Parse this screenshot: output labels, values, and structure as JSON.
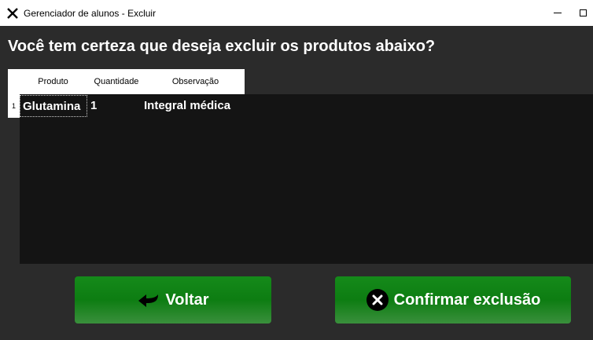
{
  "window": {
    "title": "Gerenciador de alunos - Excluir",
    "icon": "close-x-icon",
    "controls": [
      "minimize-icon",
      "maximize-icon"
    ]
  },
  "heading": "Você tem certeza que deseja excluir os produtos abaixo?",
  "table": {
    "columns": [
      "Produto",
      "Quantidade",
      "Observação"
    ],
    "rows": [
      {
        "number": "1",
        "produto": "Glutamina",
        "quantidade": "1",
        "observacao": "Integral médica"
      }
    ]
  },
  "buttons": {
    "back": {
      "label": "Voltar",
      "icon": "arrow-back-icon"
    },
    "confirm": {
      "label": "Confirmar exclusão",
      "icon": "close-circle-icon"
    }
  },
  "colors": {
    "background": "#2b2b2b",
    "table_body": "#141414",
    "button_green": "#0d7d12",
    "text": "#ffffff"
  }
}
